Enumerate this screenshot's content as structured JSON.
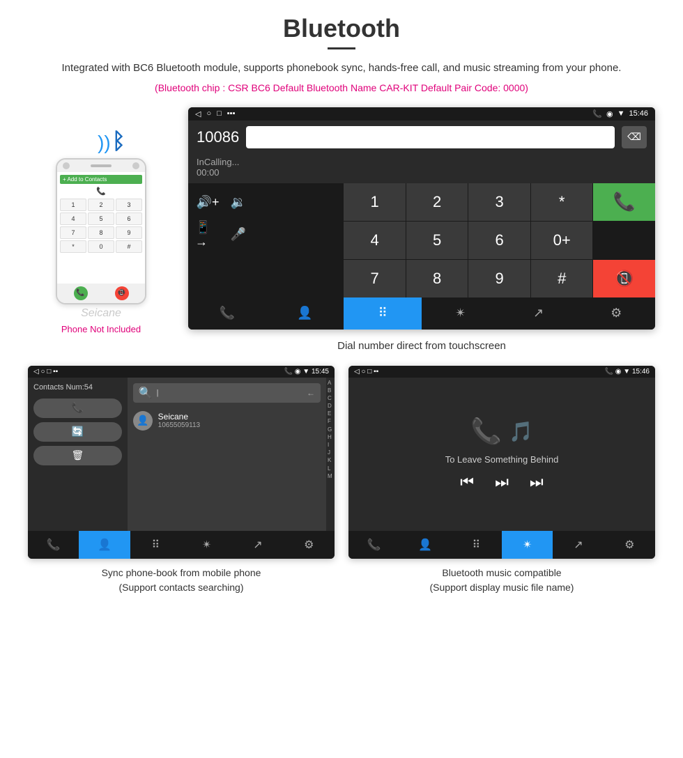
{
  "header": {
    "title": "Bluetooth",
    "subtitle": "Integrated with BC6 Bluetooth module, supports phonebook sync, hands-free call, and music streaming from your phone.",
    "specs": "(Bluetooth chip : CSR BC6    Default Bluetooth Name CAR-KIT    Default Pair Code: 0000)"
  },
  "phone_label": "Phone Not Included",
  "seicane": "Seicane",
  "main_caption": "Dial number direct from touchscreen",
  "car_screen": {
    "status_left": "◁  ○  □",
    "status_right": "📞 ◉ ▼ 15:46",
    "call_number": "10086",
    "call_status": "InCalling...",
    "call_timer": "00:00",
    "dialpad": [
      "1",
      "2",
      "3",
      "*",
      "4",
      "5",
      "6",
      "0+",
      "7",
      "8",
      "9",
      "#"
    ],
    "delete_icon": "⌫"
  },
  "bottom_left": {
    "status": "Contacts Num:54",
    "contact_name": "Seicane",
    "contact_number": "10655059113",
    "alpha": [
      "A",
      "B",
      "C",
      "D",
      "E",
      "F",
      "G",
      "H",
      "I",
      "J",
      "K",
      "L",
      "M"
    ],
    "caption_line1": "Sync phone-book from mobile phone",
    "caption_line2": "(Support contacts searching)"
  },
  "bottom_right": {
    "music_title": "To Leave Something Behind",
    "caption_line1": "Bluetooth music compatible",
    "caption_line2": "(Support display music file name)"
  },
  "nav_icons": {
    "phone": "📞",
    "contacts": "👤",
    "dialpad": "⠿",
    "bluetooth": "✴",
    "transfer": "↗",
    "settings": "⚙"
  }
}
